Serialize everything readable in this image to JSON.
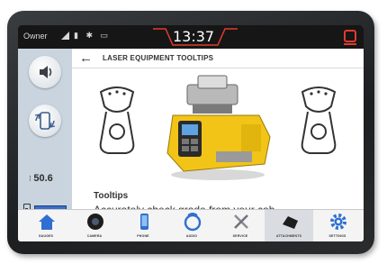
{
  "status_bar": {
    "carrier": "Owner",
    "time": "13:37"
  },
  "sidebar": {
    "tilt_value": "50.6"
  },
  "header": {
    "title": "LASER EQUIPMENT TOOLTIPS"
  },
  "tooltip": {
    "heading": "Tooltips",
    "text": "Accurately check grade from your cab."
  },
  "nav": {
    "items": [
      {
        "label": "GAUGES",
        "icon": "home-icon"
      },
      {
        "label": "CAMERA",
        "icon": "camera-icon"
      },
      {
        "label": "PHONE",
        "icon": "phone-icon"
      },
      {
        "label": "AUDIO",
        "icon": "audio-icon"
      },
      {
        "label": "SERVICE",
        "icon": "wrench-icon"
      },
      {
        "label": "ATTACHMENTS",
        "icon": "attachment-icon",
        "active": true
      },
      {
        "label": "SETTINGS",
        "icon": "gear-icon"
      }
    ]
  },
  "colors": {
    "accent_blue": "#2f6fd1",
    "laser_yellow": "#f2c418",
    "brand_red": "#e23b2c"
  }
}
